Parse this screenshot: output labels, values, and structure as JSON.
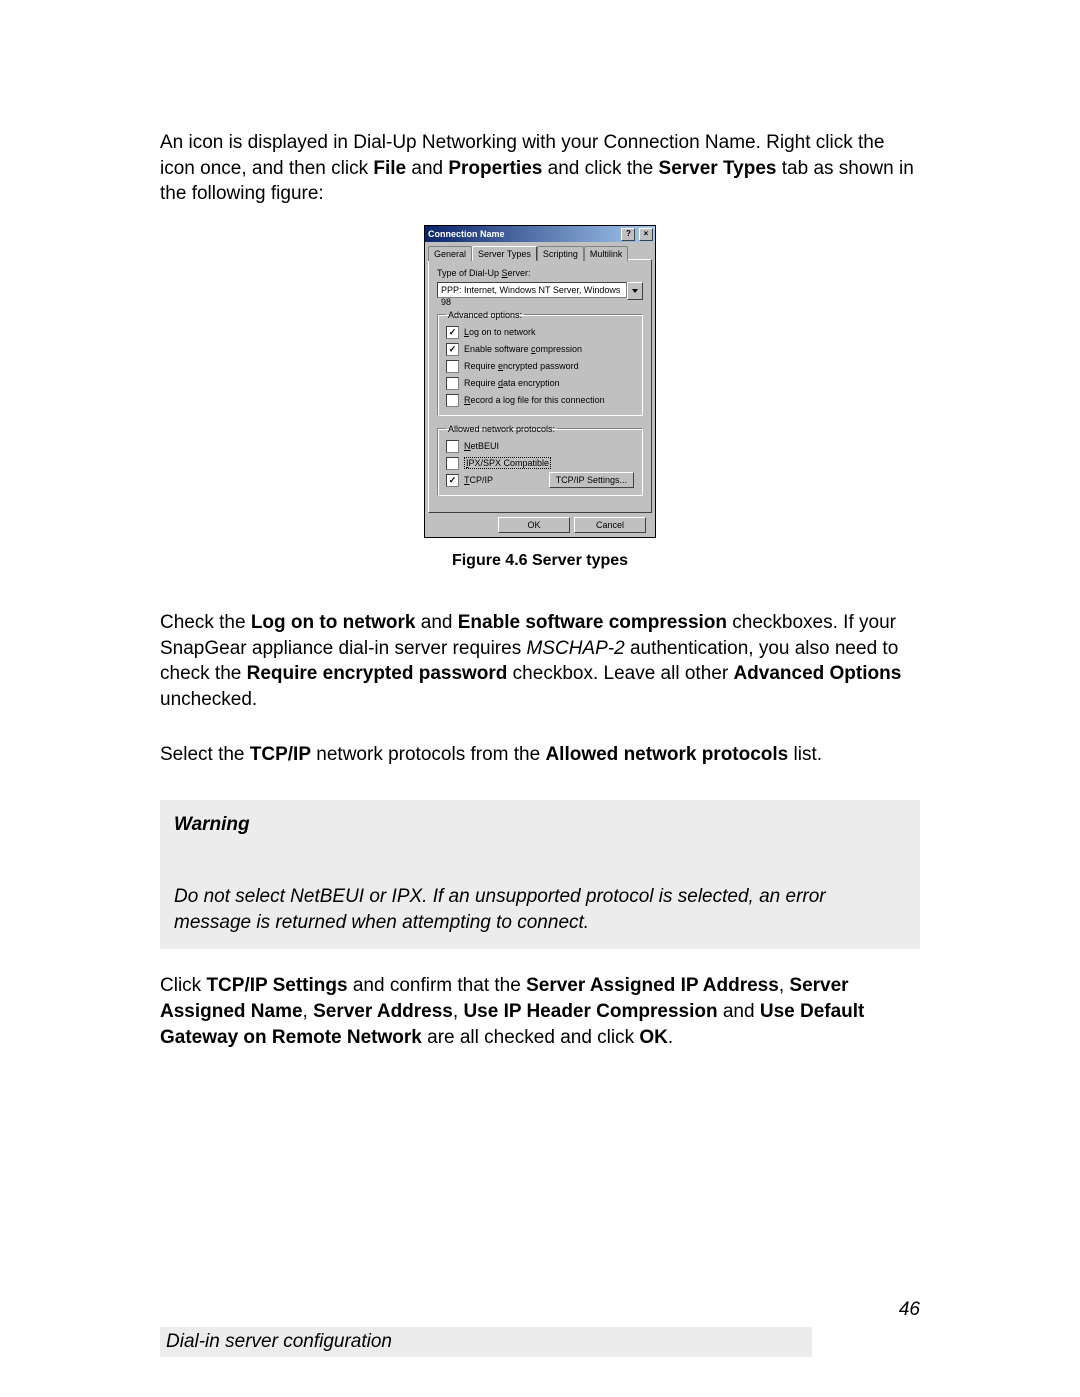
{
  "intro": {
    "pre": "An icon is displayed in Dial-Up Networking with your Connection Name. Right click the icon once, and then click ",
    "b1": "File",
    "mid1": " and ",
    "b2": "Properties",
    "mid2": " and click the ",
    "b3": "Server Types",
    "post": " tab as shown in the following figure:"
  },
  "dialog": {
    "title": "Connection Name",
    "help_btn": "?",
    "close_btn": "×",
    "tabs": {
      "general": "General",
      "server_types": "Server Types",
      "scripting": "Scripting",
      "multilink": "Multilink"
    },
    "type_label": "Type of Dial-Up Server:",
    "type_value": "PPP: Internet, Windows NT Server, Windows 98",
    "adv_legend": "Advanced options:",
    "adv": {
      "log_on": "Log on to network",
      "compression": "Enable software compression",
      "enc_pw": "Require encrypted password",
      "data_enc": "Require data encryption",
      "log_file": "Record a log file for this connection"
    },
    "proto_legend": "Allowed network protocols:",
    "proto": {
      "netbeui": "NetBEUI",
      "ipx": "IPX/SPX Compatible",
      "tcpip": "TCP/IP"
    },
    "tcpip_settings": "TCP/IP Settings...",
    "ok": "OK",
    "cancel": "Cancel"
  },
  "caption": "Figure 4.6 Server types",
  "para2": {
    "pre": "Check the ",
    "b1": "Log on to network",
    "mid1": " and ",
    "b2": "Enable software compression",
    "mid2": " checkboxes. If your SnapGear appliance dial-in server requires ",
    "i1": "MSCHAP-2",
    "mid3": " authentication, you also need to check the ",
    "b3": "Require encrypted password",
    "mid4": " checkbox. Leave all other ",
    "b4": "Advanced Options",
    "post": " unchecked."
  },
  "para3": {
    "pre": "Select the ",
    "b1": "TCP/IP",
    "mid1": " network protocols from the ",
    "b2": "Allowed network protocols",
    "post": " list."
  },
  "warning": {
    "title": "Warning",
    "text": "Do not select NetBEUI or IPX. If an unsupported protocol is selected, an error message is returned when attempting to connect."
  },
  "para4": {
    "pre": "Click ",
    "b1": "TCP/IP Settings",
    "mid1": " and confirm that the ",
    "b2": "Server Assigned IP Address",
    "mid2": ", ",
    "b3": "Server Assigned Name",
    "mid3": ", ",
    "b4": "Server Address",
    "mid4": ", ",
    "b5": "Use IP Header Compression",
    "mid5": " and ",
    "b6": "Use Default Gateway on Remote Network",
    "mid6": " are all checked and click ",
    "b7": "OK",
    "post": "."
  },
  "footer": {
    "page": "46",
    "section": "Dial-in server configuration"
  }
}
